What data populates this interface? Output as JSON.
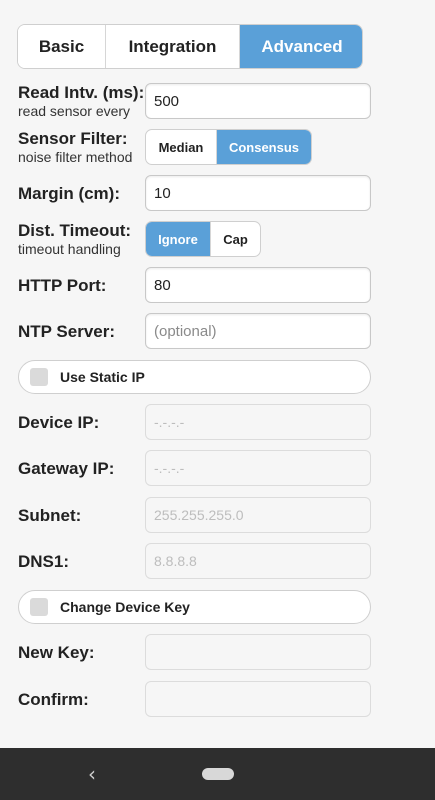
{
  "tabs": [
    {
      "label": "Basic",
      "active": false
    },
    {
      "label": "Integration",
      "active": false
    },
    {
      "label": "Advanced",
      "active": true
    }
  ],
  "read_interval": {
    "label": "Read Intv. (ms):",
    "hint": "read sensor every",
    "value": "500"
  },
  "sensor_filter": {
    "label": "Sensor Filter:",
    "hint": "noise filter method",
    "options": [
      "Median",
      "Consensus"
    ],
    "selected": "Consensus"
  },
  "margin": {
    "label": "Margin (cm):",
    "value": "10"
  },
  "dist_timeout": {
    "label": "Dist. Timeout:",
    "hint": "timeout handling",
    "options": [
      "Ignore",
      "Cap"
    ],
    "selected": "Ignore"
  },
  "http_port": {
    "label": "HTTP Port:",
    "value": "80"
  },
  "ntp_server": {
    "label": "NTP Server:",
    "value": "",
    "placeholder": "(optional)"
  },
  "static_ip": {
    "label": "Use Static IP",
    "checked": false
  },
  "device_ip": {
    "label": "Device IP:",
    "placeholder": "-.-.-.-"
  },
  "gateway_ip": {
    "label": "Gateway IP:",
    "placeholder": "-.-.-.-"
  },
  "subnet": {
    "label": "Subnet:",
    "placeholder": "255.255.255.0"
  },
  "dns1": {
    "label": "DNS1:",
    "placeholder": "8.8.8.8"
  },
  "change_key": {
    "label": "Change Device Key",
    "checked": false
  },
  "new_key": {
    "label": "New Key:",
    "value": ""
  },
  "confirm": {
    "label": "Confirm:",
    "value": ""
  },
  "colors": {
    "accent": "#5aa0d8",
    "navbar": "#2e2e2e",
    "background": "#f6f6f6"
  },
  "system_nav": {
    "back_icon": "chevron-left-icon",
    "home_icon": "home-pill-icon"
  }
}
